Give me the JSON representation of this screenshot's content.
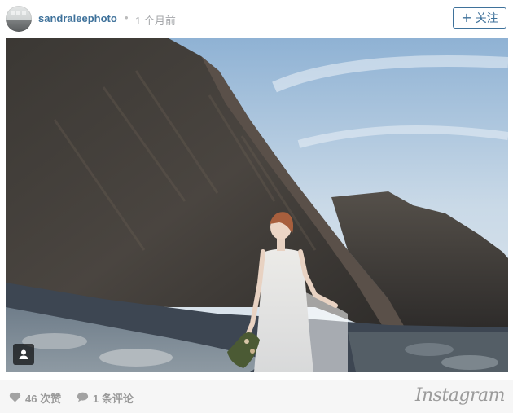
{
  "post": {
    "username": "sandraleephoto",
    "separator": "•",
    "time_ago": "1 个月前",
    "follow_label": "关注",
    "follow_icon": "plus-icon"
  },
  "photo": {
    "subject": "",
    "tag_icon": "user-tag-icon"
  },
  "footer": {
    "likes_label": "46 次赞",
    "likes_icon": "heart-icon",
    "comments_label": "1 条评论",
    "comments_icon": "speech-bubble-icon",
    "logo_text": "Instagram"
  },
  "colors": {
    "username": "#3f729b",
    "meta": "#a5a7aa",
    "footer_text": "#9a9a9a",
    "footer_bg": "#f6f6f6"
  }
}
